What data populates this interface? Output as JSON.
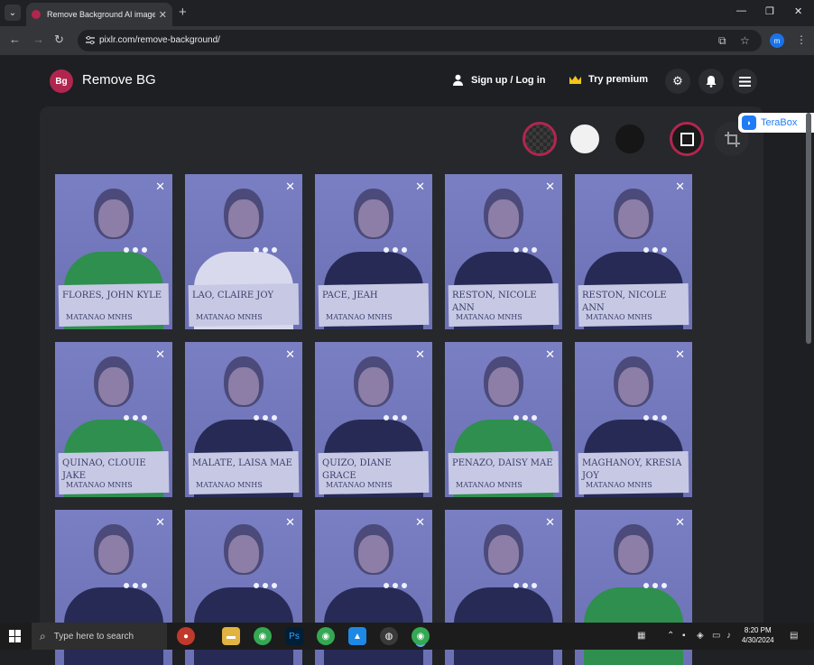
{
  "browser": {
    "tab_title": "Remove Background AI image",
    "url": "pixlr.com/remove-background/"
  },
  "header": {
    "brand": "Remove BG",
    "logo_text": "Bg",
    "signup_label": "Sign up / Log in",
    "premium_label": "Try premium"
  },
  "terabox": {
    "label": "TeraBox"
  },
  "swatches": [
    {
      "name": "transparent",
      "color": "#3a3a3a"
    },
    {
      "name": "white",
      "color": "#f1f1f1"
    },
    {
      "name": "black",
      "color": "#161616"
    }
  ],
  "accent_color": "#b1264f",
  "cards": [
    {
      "sign": "FLORES, JOHN KYLE",
      "school": "MATANAO MNHS",
      "top": "green"
    },
    {
      "sign": "LAO, CLAIRE JOY",
      "school": "MATANAO MNHS",
      "top": "white"
    },
    {
      "sign": "PACE, JEAH",
      "school": "MATANAO MNHS",
      "top": "navy"
    },
    {
      "sign": "RESTON, NICOLE ANN",
      "school": "MATANAO MNHS",
      "top": "navy"
    },
    {
      "sign": "RESTON, NICOLE ANN",
      "school": "MATANAO MNHS",
      "top": "navy"
    },
    {
      "sign": "QUINAO, CLOUIE JAKE",
      "school": "MATANAO MNHS",
      "top": "green"
    },
    {
      "sign": "MALATE, LAISA MAE",
      "school": "MATANAO MNHS",
      "top": "navy"
    },
    {
      "sign": "QUIZO, DIANE GRACE",
      "school": "MATANAO MNHS",
      "top": "navy"
    },
    {
      "sign": "PENAZO, DAISY MAE",
      "school": "MATANAO MNHS",
      "top": "green"
    },
    {
      "sign": "MAGHANOY, KRESIA JOY",
      "school": "MATANAO MNHS",
      "top": "navy"
    },
    {
      "sign": "",
      "school": "",
      "top": "navy"
    },
    {
      "sign": "",
      "school": "",
      "top": "navy"
    },
    {
      "sign": "",
      "school": "",
      "top": "navy"
    },
    {
      "sign": "",
      "school": "",
      "top": "navy"
    },
    {
      "sign": "",
      "school": "",
      "top": "green"
    }
  ],
  "taskbar": {
    "search_placeholder": "Type here to search",
    "time": "8:20 PM",
    "date": "4/30/2024"
  }
}
